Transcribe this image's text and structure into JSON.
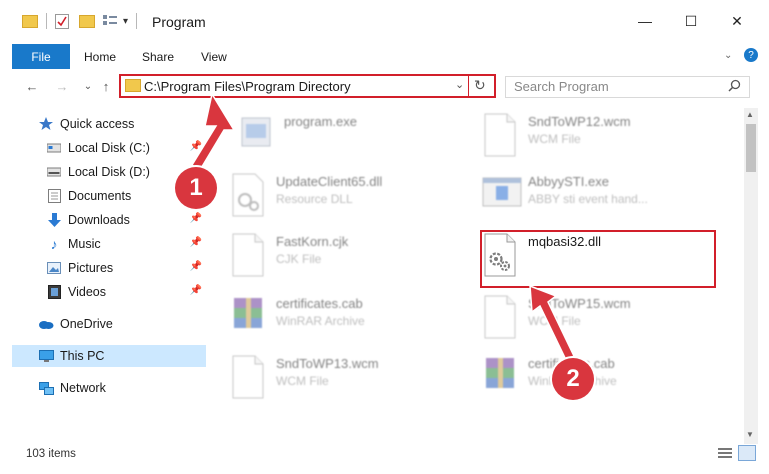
{
  "window": {
    "title": "Program",
    "minimize": "—",
    "maximize": "☐",
    "close": "✕"
  },
  "ribbon": {
    "file": "File",
    "tabs": [
      "Home",
      "Share",
      "View"
    ],
    "help": "?"
  },
  "navigation": {
    "back": "←",
    "forward": "→",
    "recent": "⌄",
    "up": "↑",
    "address": "C:\\Program Files\\Program Directory",
    "refresh": "↻",
    "dropdown": "⌄",
    "search_placeholder": "Search Program"
  },
  "sidebar": {
    "items": [
      {
        "label": "Quick access",
        "icon": "star-icon",
        "pinned": false,
        "selected": false
      },
      {
        "label": "Local Disk (C:)",
        "icon": "drive-icon",
        "pinned": true,
        "selected": false
      },
      {
        "label": "Local Disk (D:)",
        "icon": "drive-icon",
        "pinned": true,
        "selected": false
      },
      {
        "label": "Documents",
        "icon": "documents-icon",
        "pinned": true,
        "selected": false
      },
      {
        "label": "Downloads",
        "icon": "download-icon",
        "pinned": true,
        "selected": false
      },
      {
        "label": "Music",
        "icon": "music-icon",
        "pinned": true,
        "selected": false
      },
      {
        "label": "Pictures",
        "icon": "pictures-icon",
        "pinned": true,
        "selected": false
      },
      {
        "label": "Videos",
        "icon": "videos-icon",
        "pinned": true,
        "selected": false
      },
      {
        "label": "OneDrive",
        "icon": "cloud-icon",
        "pinned": false,
        "selected": false
      },
      {
        "label": "This PC",
        "icon": "computer-icon",
        "pinned": false,
        "selected": true
      },
      {
        "label": "Network",
        "icon": "network-icon",
        "pinned": false,
        "selected": false
      }
    ]
  },
  "files": [
    {
      "name": "program.exe",
      "type": "",
      "icon": "exe-icon",
      "blurred": true
    },
    {
      "name": "SndToWP12.wcm",
      "type": "WCM File",
      "icon": "blank-file-icon",
      "blurred": true
    },
    {
      "name": "UpdateClient65.dll",
      "type": "Resource DLL",
      "icon": "dll-icon",
      "blurred": true
    },
    {
      "name": "AbbyySTI.exe",
      "type": "ABBY sti event hand...",
      "icon": "exe-window-icon",
      "blurred": true
    },
    {
      "name": "FastKorn.cjk",
      "type": "CJK File",
      "icon": "blank-file-icon",
      "blurred": true
    },
    {
      "name": "mqbasi32.dll",
      "type": "",
      "icon": "dll-icon",
      "blurred": false
    },
    {
      "name": "certificates.cab",
      "type": "WinRAR Archive",
      "icon": "winrar-icon",
      "blurred": true
    },
    {
      "name": "SndToWP15.wcm",
      "type": "WCM File",
      "icon": "blank-file-icon",
      "blurred": true
    },
    {
      "name": "SndToWP13.wcm",
      "type": "WCM File",
      "icon": "blank-file-icon",
      "blurred": true
    },
    {
      "name": "certificates.cab",
      "type": "WinRAR Archive",
      "icon": "winrar-icon",
      "blurred": true
    }
  ],
  "annotations": {
    "step1": "1",
    "step2": "2",
    "accent_color": "#d21f2a"
  },
  "status": {
    "item_count": "103 items"
  }
}
